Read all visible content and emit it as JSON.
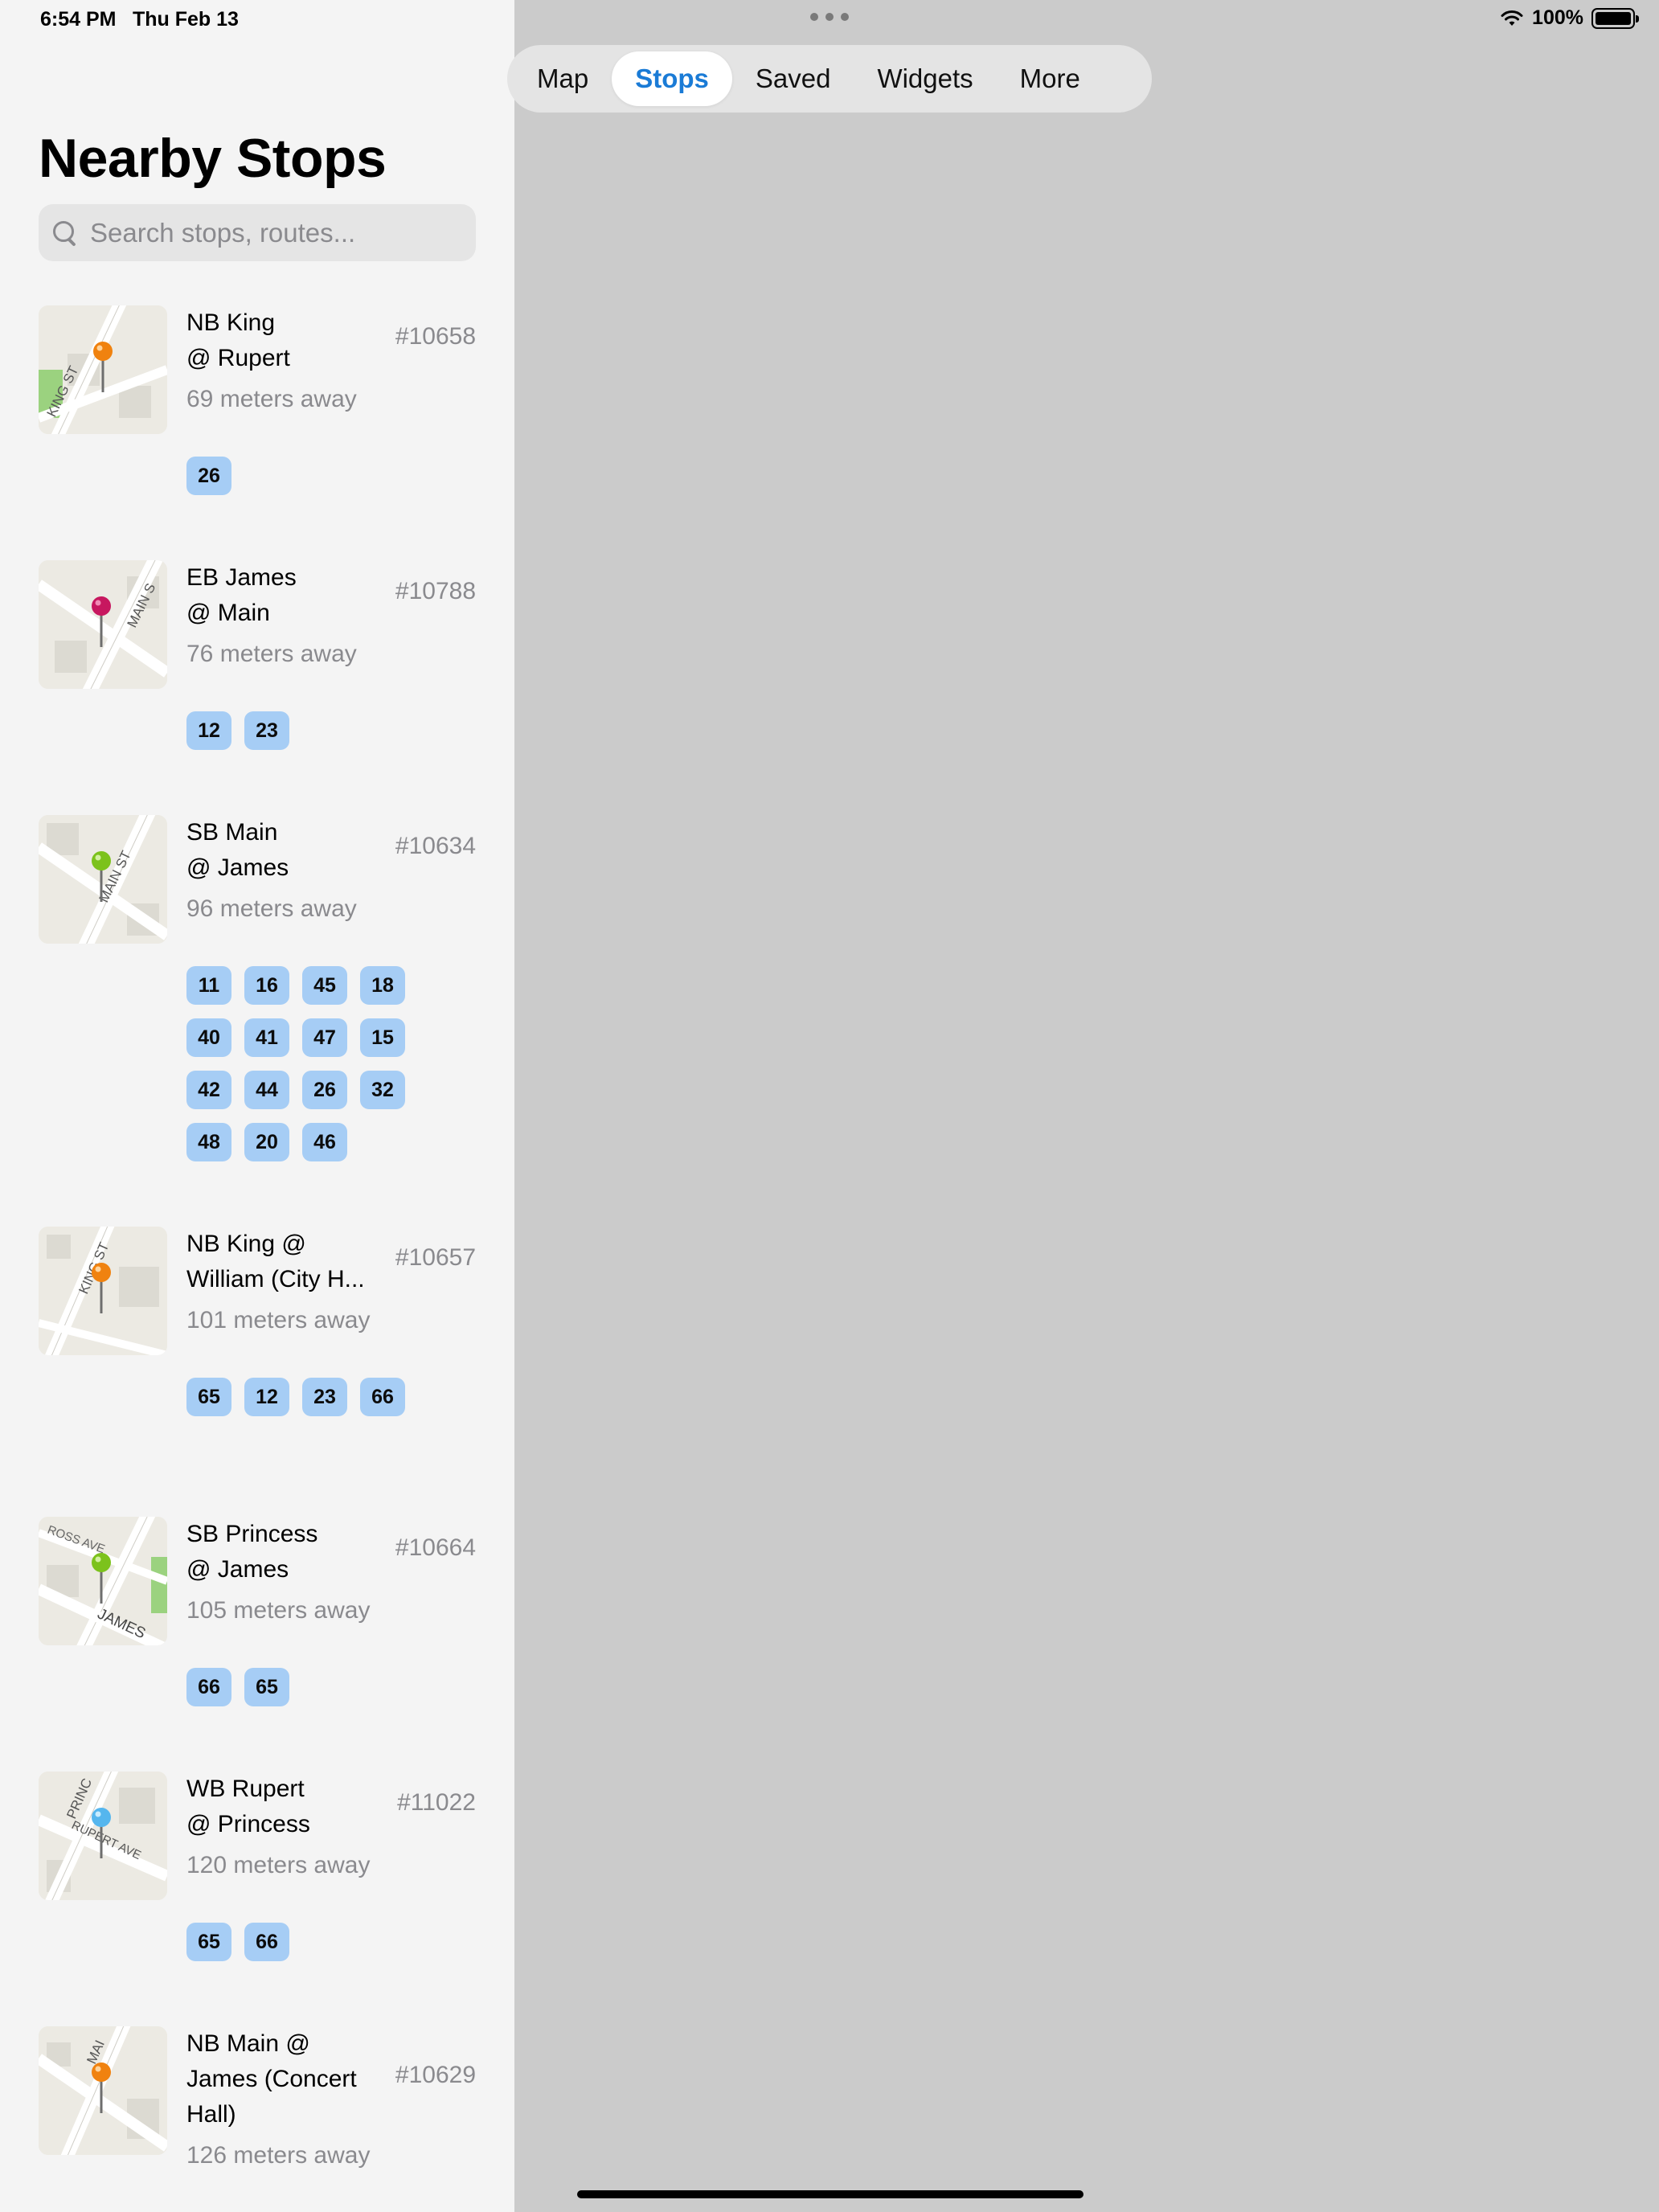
{
  "status_bar": {
    "time": "6:54 PM",
    "date": "Thu Feb 13",
    "battery": "100%"
  },
  "tabs": [
    {
      "label": "Map",
      "active": false
    },
    {
      "label": "Stops",
      "active": true
    },
    {
      "label": "Saved",
      "active": false
    },
    {
      "label": "Widgets",
      "active": false
    },
    {
      "label": "More",
      "active": false
    }
  ],
  "title": "Nearby Stops",
  "search": {
    "placeholder": "Search stops, routes...",
    "value": ""
  },
  "colors": {
    "accent": "#1a7bd6",
    "badge": "#a6cdf5",
    "pin_orange": "#f0820f",
    "pin_magenta": "#c7175f",
    "pin_green": "#7cc21c",
    "pin_blue": "#55b6ee"
  },
  "stops": [
    {
      "name_lines": [
        "NB King",
        "@ Rupert"
      ],
      "code": "#10658",
      "distance": "69 meters away",
      "routes": [
        "26"
      ],
      "pin": "orange-pin-icon",
      "map_label": "KING ST"
    },
    {
      "name_lines": [
        "EB James",
        "@ Main"
      ],
      "code": "#10788",
      "distance": "76 meters away",
      "routes": [
        "12",
        "23"
      ],
      "pin": "magenta-pin-icon",
      "map_label": "MAIN S"
    },
    {
      "name_lines": [
        "SB Main",
        "@ James"
      ],
      "code": "#10634",
      "distance": "96 meters away",
      "routes": [
        "11",
        "16",
        "45",
        "18",
        "40",
        "41",
        "47",
        "15",
        "42",
        "44",
        "26",
        "32",
        "48",
        "20",
        "46"
      ],
      "pin": "green-pin-icon",
      "map_label": "MAIN ST"
    },
    {
      "name_lines": [
        "NB King @",
        "William (City H..."
      ],
      "code": "#10657",
      "distance": "101 meters away",
      "routes": [
        "65",
        "12",
        "23",
        "66"
      ],
      "pin": "orange-pin-icon",
      "map_label": "KING ST"
    },
    {
      "name_lines": [
        "SB Princess",
        "@ James"
      ],
      "code": "#10664",
      "distance": "105 meters away",
      "routes": [
        "66",
        "65"
      ],
      "pin": "green-pin-icon",
      "map_label": "JAMES",
      "map_label_2": "ROSS AVE"
    },
    {
      "name_lines": [
        "WB Rupert",
        "@ Princess"
      ],
      "code": "#11022",
      "distance": "120 meters away",
      "routes": [
        "65",
        "66"
      ],
      "pin": "blue-pin-icon",
      "map_label": "RUPERT AVE",
      "map_label_2": "PRINC"
    },
    {
      "name_lines": [
        "NB Main @",
        "James (Concert",
        "Hall)"
      ],
      "code": "#10629",
      "distance": "126 meters away",
      "routes": [],
      "pin": "orange-pin-icon",
      "map_label": "MAI"
    }
  ]
}
